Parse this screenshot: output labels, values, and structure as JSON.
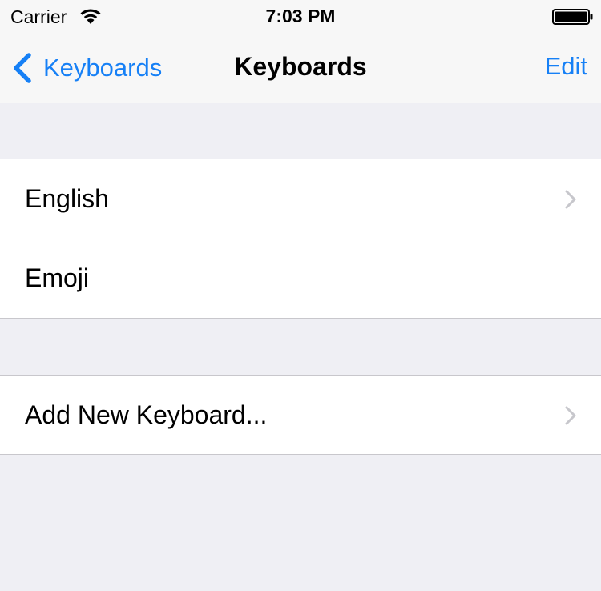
{
  "status_bar": {
    "carrier": "Carrier",
    "time": "7:03 PM",
    "icons": [
      "wifi-icon",
      "battery-icon"
    ]
  },
  "nav_bar": {
    "back_label": "Keyboards",
    "title": "Keyboards",
    "edit_label": "Edit"
  },
  "keyboards_section": {
    "items": [
      {
        "label": "English",
        "has_disclosure": true
      },
      {
        "label": "Emoji",
        "has_disclosure": false
      }
    ]
  },
  "add_section": {
    "items": [
      {
        "label": "Add New Keyboard...",
        "has_disclosure": true
      }
    ]
  },
  "colors": {
    "accent": "#1680f6",
    "background": "#efeff4",
    "separator": "#c8c7cc",
    "disclosure": "#c7c7cc"
  }
}
